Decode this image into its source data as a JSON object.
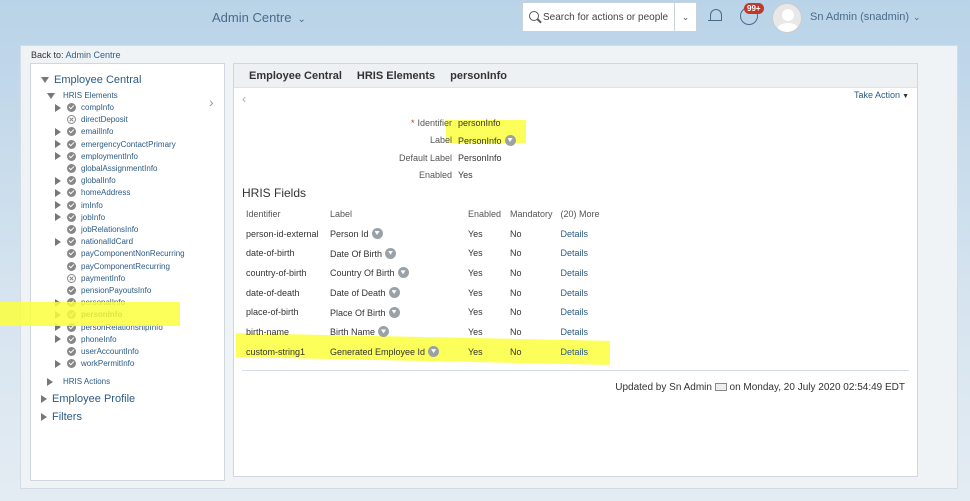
{
  "shell": {
    "title": "Admin Centre",
    "search_placeholder": "Search for actions or people",
    "notification_count": "99+",
    "user": "Sn Admin (snadmin)"
  },
  "backto": {
    "prefix": "Back to:",
    "link": "Admin Centre"
  },
  "tree": {
    "root": "Employee Central",
    "hris_elements": "HRIS Elements",
    "items": [
      {
        "label": "compInfo",
        "expander": true,
        "icon": "check"
      },
      {
        "label": "directDeposit",
        "expander": false,
        "icon": "x"
      },
      {
        "label": "emailInfo",
        "expander": true,
        "icon": "check"
      },
      {
        "label": "emergencyContactPrimary",
        "expander": true,
        "icon": "check"
      },
      {
        "label": "employmentInfo",
        "expander": true,
        "icon": "check"
      },
      {
        "label": "globalAssignmentInfo",
        "expander": false,
        "icon": "check"
      },
      {
        "label": "globalInfo",
        "expander": true,
        "icon": "check"
      },
      {
        "label": "homeAddress",
        "expander": true,
        "icon": "check"
      },
      {
        "label": "imInfo",
        "expander": true,
        "icon": "check"
      },
      {
        "label": "jobInfo",
        "expander": true,
        "icon": "check"
      },
      {
        "label": "jobRelationsInfo",
        "expander": false,
        "icon": "check"
      },
      {
        "label": "nationalIdCard",
        "expander": true,
        "icon": "check"
      },
      {
        "label": "payComponentNonRecurring",
        "expander": false,
        "icon": "check"
      },
      {
        "label": "payComponentRecurring",
        "expander": false,
        "icon": "check"
      },
      {
        "label": "paymentInfo",
        "expander": false,
        "icon": "x"
      },
      {
        "label": "pensionPayoutsInfo",
        "expander": false,
        "icon": "check"
      },
      {
        "label": "personalInfo",
        "expander": true,
        "icon": "check"
      },
      {
        "label": "personInfo",
        "expander": true,
        "icon": "check",
        "selected": true
      },
      {
        "label": "personRelationshipInfo",
        "expander": true,
        "icon": "check"
      },
      {
        "label": "phoneInfo",
        "expander": true,
        "icon": "check"
      },
      {
        "label": "userAccountInfo",
        "expander": false,
        "icon": "check"
      },
      {
        "label": "workPermitInfo",
        "expander": true,
        "icon": "check"
      }
    ],
    "hris_actions": "HRIS Actions",
    "employee_profile": "Employee Profile",
    "filters": "Filters"
  },
  "content": {
    "crumbs": [
      "Employee Central",
      "HRIS Elements",
      "personInfo"
    ],
    "take_action": "Take Action",
    "form": [
      {
        "key": "Identifier",
        "value": "personInfo",
        "required": true
      },
      {
        "key": "Label",
        "value": "PersonInfo",
        "icon": true
      },
      {
        "key": "Default Label",
        "value": "PersonInfo"
      },
      {
        "key": "Enabled",
        "value": "Yes"
      }
    ],
    "section_title": "HRIS Fields",
    "columns": [
      "Identifier",
      "Label",
      "Enabled",
      "Mandatory",
      "(20) More"
    ],
    "rows": [
      [
        "person-id-external",
        "Person Id",
        "Yes",
        "No",
        "Details"
      ],
      [
        "date-of-birth",
        "Date Of Birth",
        "Yes",
        "No",
        "Details"
      ],
      [
        "country-of-birth",
        "Country Of Birth",
        "Yes",
        "No",
        "Details"
      ],
      [
        "date-of-death",
        "Date of Death",
        "Yes",
        "No",
        "Details"
      ],
      [
        "place-of-birth",
        "Place Of Birth",
        "Yes",
        "No",
        "Details"
      ],
      [
        "birth-name",
        "Birth Name",
        "Yes",
        "No",
        "Details"
      ],
      [
        "custom-string1",
        "Generated Employee Id",
        "Yes",
        "No",
        "Details"
      ]
    ],
    "updated_prefix": "Updated by Sn Admin",
    "updated_suffix": "on Monday, 20 July 2020 02:54:49 EDT"
  },
  "colors": {
    "accent": "#2c5b84",
    "highlight": "#fbff3c"
  }
}
